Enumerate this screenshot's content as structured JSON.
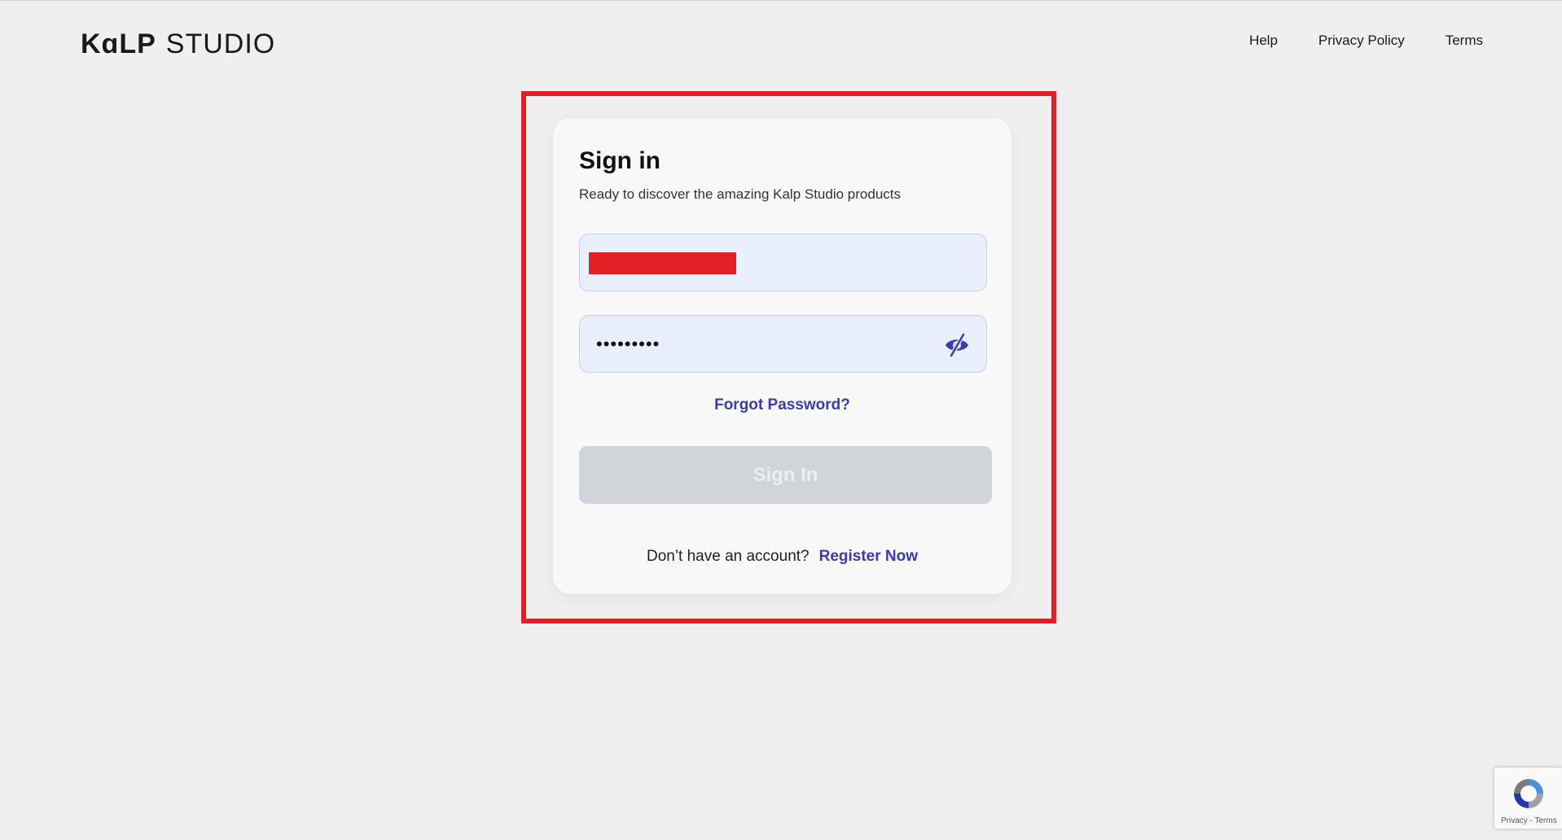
{
  "brand": {
    "logo_bold": "KɑLP",
    "logo_light": "STUDIO"
  },
  "nav": {
    "help": "Help",
    "privacy": "Privacy Policy",
    "terms": "Terms"
  },
  "signin": {
    "title": "Sign in",
    "subtitle": "Ready to discover the amazing Kalp Studio products",
    "email_value": "",
    "password_value": "•••••••••",
    "forgot_label": "Forgot Password?",
    "submit_label": "Sign In",
    "register_prompt": "Don’t have an account?",
    "register_label": "Register Now"
  },
  "recaptcha": {
    "footer": "Privacy - Terms"
  },
  "colors": {
    "accent": "#3b3cae",
    "highlight": "#e31e24",
    "field_bg": "#e8f0fe",
    "button_disabled": "#d1d4d8"
  },
  "icons": {
    "password_toggle": "eye-slash-icon",
    "recaptcha": "recaptcha-icon"
  }
}
